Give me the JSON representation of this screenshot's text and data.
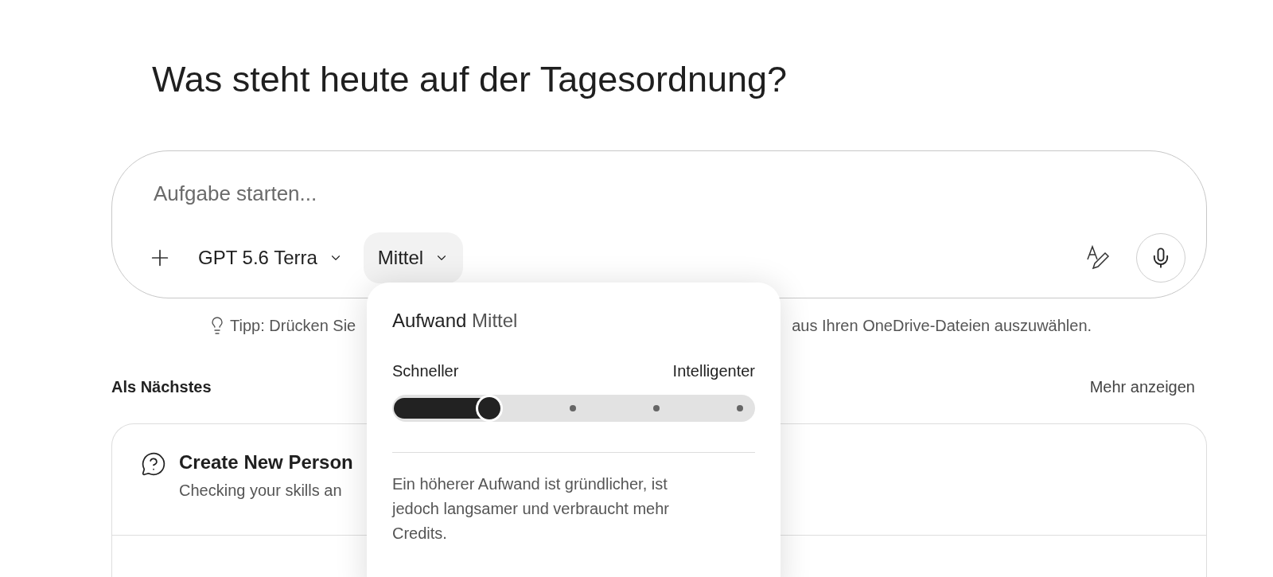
{
  "heading": "Was steht heute auf der Tagesordnung?",
  "composer": {
    "placeholder": "Aufgabe starten...",
    "model": "GPT 5.6 Terra",
    "effort": "Mittel"
  },
  "tip": {
    "before": "Tipp: Drücken Sie",
    "after": "aus Ihren OneDrive-Dateien auszuwählen."
  },
  "effort_popover": {
    "title": "Aufwand",
    "value": "Mittel",
    "left_label": "Schneller",
    "right_label": "Intelligenter",
    "level": 0.25,
    "description": "Ein höherer Aufwand ist gründlicher, ist jedoch langsamer und verbraucht mehr Credits."
  },
  "next": {
    "title": "Als Nächstes",
    "more": "Mehr anzeigen",
    "items": [
      {
        "title": "Create New Person",
        "subtitle": "Checking your skills an"
      }
    ]
  }
}
